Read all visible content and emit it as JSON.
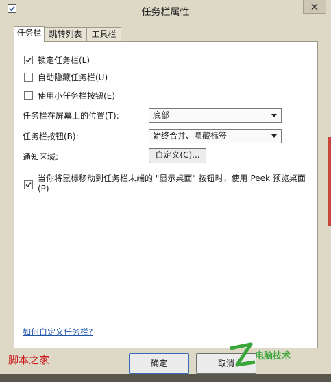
{
  "window": {
    "title": "任务栏属性"
  },
  "tabs": [
    {
      "label": "任务栏"
    },
    {
      "label": "跳转列表"
    },
    {
      "label": "工具栏"
    }
  ],
  "options": {
    "lock": {
      "label": "锁定任务栏(L)",
      "checked": true
    },
    "autohide": {
      "label": "自动隐藏任务栏(U)",
      "checked": false
    },
    "small_buttons": {
      "label": "使用小任务栏按钮(E)",
      "checked": false
    }
  },
  "position": {
    "label": "任务栏在屏幕上的位置(T):",
    "value": "底部"
  },
  "buttons_setting": {
    "label": "任务栏按钮(B):",
    "value": "始终合并、隐藏标签"
  },
  "notification": {
    "label": "通知区域:",
    "button": "自定义(C)..."
  },
  "peek": {
    "line1": "当你将鼠标移动到任务栏末端的 \"显示桌面\" 按钮时，使用 Peek 预览桌面",
    "line2": "(P)",
    "checked": true
  },
  "help_link": "如何自定义任务栏?",
  "footer": {
    "ok_label": "确定",
    "cancel_label": "取消"
  },
  "watermarks": {
    "left": "脚本之家",
    "right": "电脑技术"
  },
  "colors": {
    "link": "#1f56a8",
    "watermark": "#cc1b1b",
    "logo_green": "#3aa63a"
  }
}
